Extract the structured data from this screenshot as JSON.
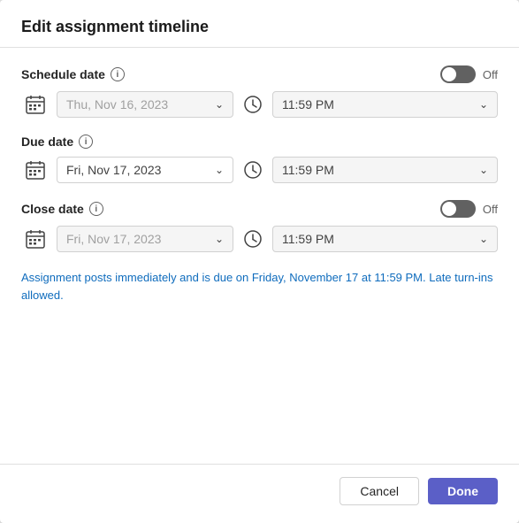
{
  "modal": {
    "title": "Edit assignment timeline"
  },
  "schedule_date": {
    "label": "Schedule date",
    "toggle_state": "off",
    "toggle_label": "Off",
    "date_value": "Thu, Nov 16, 2023",
    "time_value": "11:59 PM",
    "disabled": true
  },
  "due_date": {
    "label": "Due date",
    "date_value": "Fri, Nov 17, 2023",
    "time_value": "11:59 PM",
    "disabled": false
  },
  "close_date": {
    "label": "Close date",
    "toggle_state": "off",
    "toggle_label": "Off",
    "date_value": "Fri, Nov 17, 2023",
    "time_value": "11:59 PM",
    "disabled": true
  },
  "info_text": "Assignment posts immediately and is due on Friday, November 17 at 11:59 PM. Late turn-ins allowed.",
  "footer": {
    "cancel_label": "Cancel",
    "done_label": "Done"
  }
}
